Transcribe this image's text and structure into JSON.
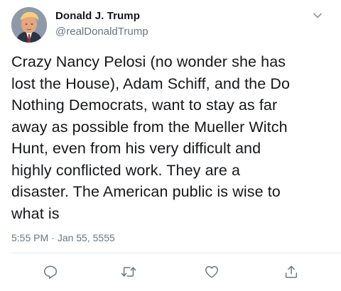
{
  "tweet": {
    "author_name": "Donald J. Trump",
    "author_handle": "@realDonaldTrump",
    "text": "Crazy Nancy Pelosi (no wonder she has\nlost the House), Adam Schiff, and the Do\nNothing Democrats, want to stay as far\naway as possible from the Mueller Witch\nHunt, even from his very difficult and\nhighly conflicted work. They are a\ndisaster. The American public is wise to\nwhat is",
    "time": "5:55 PM",
    "separator": "·",
    "date": "Jan 55, 5555"
  },
  "icons": {
    "menu": "chevron-down-icon",
    "reply": "reply-icon",
    "retweet": "retweet-icon",
    "like": "heart-icon",
    "share": "share-icon"
  },
  "colors": {
    "text": "#14171a",
    "secondary": "#657786",
    "divider": "#e6ecf0"
  }
}
